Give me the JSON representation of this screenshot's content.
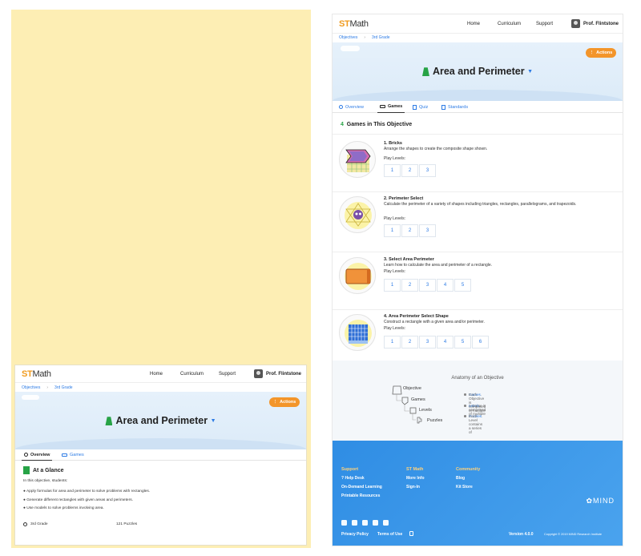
{
  "brand": {
    "st": "ST",
    "math": "Math",
    "accent": "#f09b1f"
  },
  "nav": {
    "home": "Home",
    "curriculum": "Curriculum",
    "support": "Support",
    "user": "Prof. Flintstone"
  },
  "breadcrumb": {
    "objectives": "Objectives",
    "grade": "3rd Grade"
  },
  "hero": {
    "title": "Area and Perimeter",
    "actions": "Actions",
    "actions_icon": "vertical-dots"
  },
  "tabs": {
    "overview": "Overview",
    "games": "Games",
    "quiz": "Quiz",
    "standards": "Standards"
  },
  "overview": {
    "heading": "At a Glance",
    "intro": "In this objective, students:",
    "bullets": [
      "Apply formulas for area and perimeter to solve problems with rectangles.",
      "Generate different rectangles with given areas and perimeters.",
      "Use models to solve problems involving area."
    ],
    "grade": "3rd Grade",
    "puzzles": "121 Puzzles"
  },
  "games_section": {
    "count": "4",
    "title": "Games in This Objective",
    "play_levels_label": "Play Levels:",
    "games": [
      {
        "name": "1. Bricks",
        "desc": "Arrange the shapes to create the composite shape shown.",
        "levels": [
          "1",
          "2",
          "3"
        ]
      },
      {
        "name": "2. Perimeter Select",
        "desc": "Calculate the perimeter of a variety of shapes including triangles, rectangles, parallelograms, and trapezoids.",
        "levels": [
          "1",
          "2",
          "3"
        ]
      },
      {
        "name": "3. Select Area Perimeter",
        "desc": "Learn how to calculate the area and perimeter of a rectangle.",
        "levels": [
          "1",
          "2",
          "3",
          "4",
          "5"
        ]
      },
      {
        "name": "4. Area Perimeter Select Shape",
        "desc": "Construct a rectangle with a given area and/or perimeter.",
        "levels": [
          "1",
          "2",
          "3",
          "4",
          "5",
          "6"
        ]
      }
    ]
  },
  "anatomy": {
    "title": "Anatomy of an Objective",
    "tree": [
      "Objective",
      "Games",
      "Levels",
      "Puzzles"
    ],
    "bullets": [
      {
        "pre": "Each Objective is composed of multiple ",
        "hl": "Games",
        "post": "."
      },
      {
        "pre": "A Game is comprised of multiple ",
        "hl": "Levels",
        "post": "."
      },
      {
        "pre": "Each Level contains a series of ",
        "hl": "Puzzles",
        "post": "."
      }
    ]
  },
  "footer": {
    "support_h": "Support",
    "support_links": [
      "Help Desk",
      "On-Demand Learning",
      "Printable Resources"
    ],
    "stmath_h": "ST Math",
    "stmath_links": [
      "More Info",
      "Sign-In"
    ],
    "community_h": "Community",
    "community_links": [
      "Blog",
      "Kit Store"
    ],
    "mind": "MIND",
    "privacy": "Privacy Policy",
    "terms": "Terms of Use",
    "version": "Version 4.0.0",
    "copyright": "Copyright © 2019 MIND Research Institute"
  }
}
